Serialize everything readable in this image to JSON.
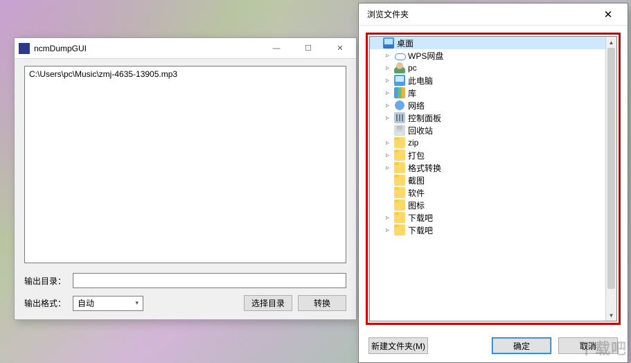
{
  "main": {
    "title": "ncmDumpGUI",
    "file_entry": "C:\\Users\\pc\\Music\\zmj-4635-13905.mp3",
    "out_dir_label": "输出目录：",
    "out_dir_value": "",
    "out_format_label": "输出格式：",
    "format_selected": "自动",
    "choose_dir_btn": "选择目录",
    "convert_btn": "转换",
    "win_min": "—",
    "win_max": "☐",
    "win_close": "✕"
  },
  "dialog": {
    "title": "浏览文件夹",
    "new_folder_btn": "新建文件夹(M)",
    "ok_btn": "确定",
    "cancel_btn": "取消",
    "close": "✕",
    "tree": [
      {
        "label": "桌面",
        "level": 1,
        "icon": "desktop",
        "expandable": false,
        "selected": true
      },
      {
        "label": "WPS网盘",
        "level": 2,
        "icon": "cloud",
        "expandable": true
      },
      {
        "label": "pc",
        "level": 2,
        "icon": "user",
        "expandable": true
      },
      {
        "label": "此电脑",
        "level": 2,
        "icon": "pc",
        "expandable": true
      },
      {
        "label": "库",
        "level": 2,
        "icon": "lib",
        "expandable": true
      },
      {
        "label": "网络",
        "level": 2,
        "icon": "net",
        "expandable": true
      },
      {
        "label": "控制面板",
        "level": 2,
        "icon": "panel",
        "expandable": true
      },
      {
        "label": "回收站",
        "level": 2,
        "icon": "bin",
        "expandable": false
      },
      {
        "label": "zip",
        "level": 2,
        "icon": "folder",
        "expandable": true
      },
      {
        "label": "打包",
        "level": 2,
        "icon": "folder",
        "expandable": true
      },
      {
        "label": "格式转换",
        "level": 2,
        "icon": "folder",
        "expandable": true
      },
      {
        "label": "截图",
        "level": 2,
        "icon": "folder",
        "expandable": false
      },
      {
        "label": "软件",
        "level": 2,
        "icon": "folder",
        "expandable": false
      },
      {
        "label": "图标",
        "level": 2,
        "icon": "folder",
        "expandable": false
      },
      {
        "label": "下载吧",
        "level": 2,
        "icon": "folder",
        "expandable": true
      },
      {
        "label": "下载吧",
        "level": 2,
        "icon": "folder",
        "expandable": true
      }
    ]
  },
  "watermark": "下载吧"
}
